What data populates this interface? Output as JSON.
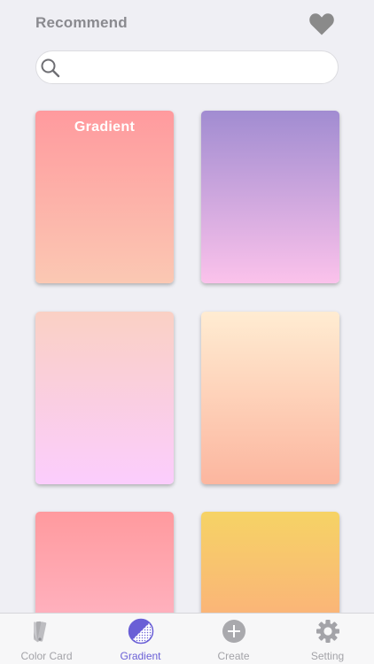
{
  "header": {
    "title": "Recommend"
  },
  "search": {
    "value": "",
    "placeholder": ""
  },
  "cards": [
    {
      "label": "Gradient",
      "colors": [
        "#ff9a9e",
        "#fbc8b3"
      ]
    },
    {
      "label": "",
      "colors": [
        "#a18cd1",
        "#fbc2eb"
      ]
    },
    {
      "label": "",
      "colors": [
        "#fad0c4",
        "#fbcdfd"
      ]
    },
    {
      "label": "",
      "colors": [
        "#ffecd2",
        "#fcb69f"
      ]
    },
    {
      "label": "",
      "colors": [
        "#ff9a9e",
        "#ffc0d3"
      ]
    },
    {
      "label": "",
      "colors": [
        "#f6d365",
        "#fda085"
      ]
    }
  ],
  "tabs": [
    {
      "label": "Color Card",
      "icon": "color-swatch-fan-icon",
      "active": false
    },
    {
      "label": "Gradient",
      "icon": "gradient-circle-icon",
      "active": true
    },
    {
      "label": "Create",
      "icon": "plus-circle-icon",
      "active": false
    },
    {
      "label": "Setting",
      "icon": "gear-icon",
      "active": false
    }
  ],
  "colors": {
    "background": "#efeff4",
    "accent": "#6a5fd6",
    "inactive": "#a3a3a8",
    "title": "#8a8a8f",
    "heart": "#8a8a8a"
  }
}
